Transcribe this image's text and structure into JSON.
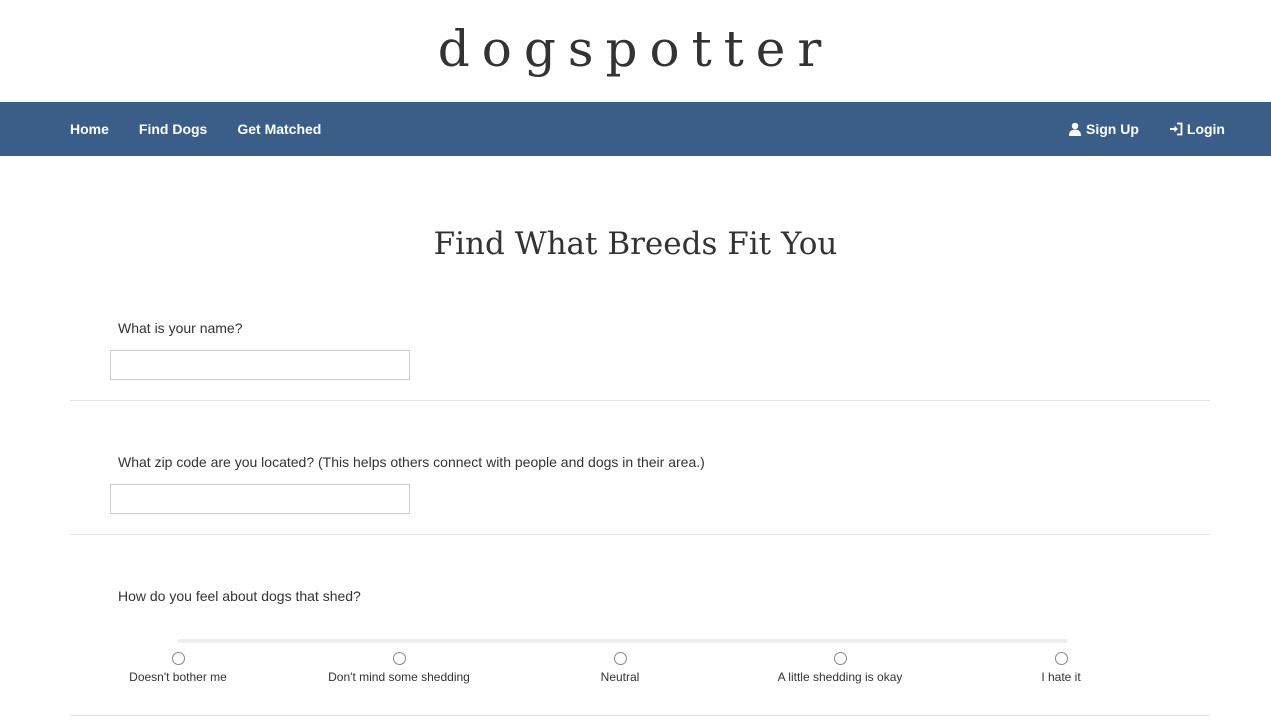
{
  "site": {
    "logo": "dogspotter"
  },
  "nav": {
    "left": [
      {
        "label": "Home"
      },
      {
        "label": "Find Dogs"
      },
      {
        "label": "Get Matched"
      }
    ],
    "right": [
      {
        "label": "Sign Up",
        "icon": "user-icon"
      },
      {
        "label": "Login",
        "icon": "login-icon"
      }
    ],
    "background": "#3a5e87"
  },
  "page": {
    "title": "Find What Breeds Fit You"
  },
  "questions": [
    {
      "label": "What is your name?",
      "type": "text",
      "value": ""
    },
    {
      "label": "What zip code are you located? (This helps others connect with people and dogs in their area.)",
      "type": "text",
      "value": ""
    },
    {
      "label": "How do you feel about dogs that shed?",
      "type": "scale",
      "options": [
        "Doesn't bother me",
        "Don't mind some shedding",
        "Neutral",
        "A little shedding is okay",
        "I hate it"
      ],
      "selected": null
    }
  ]
}
